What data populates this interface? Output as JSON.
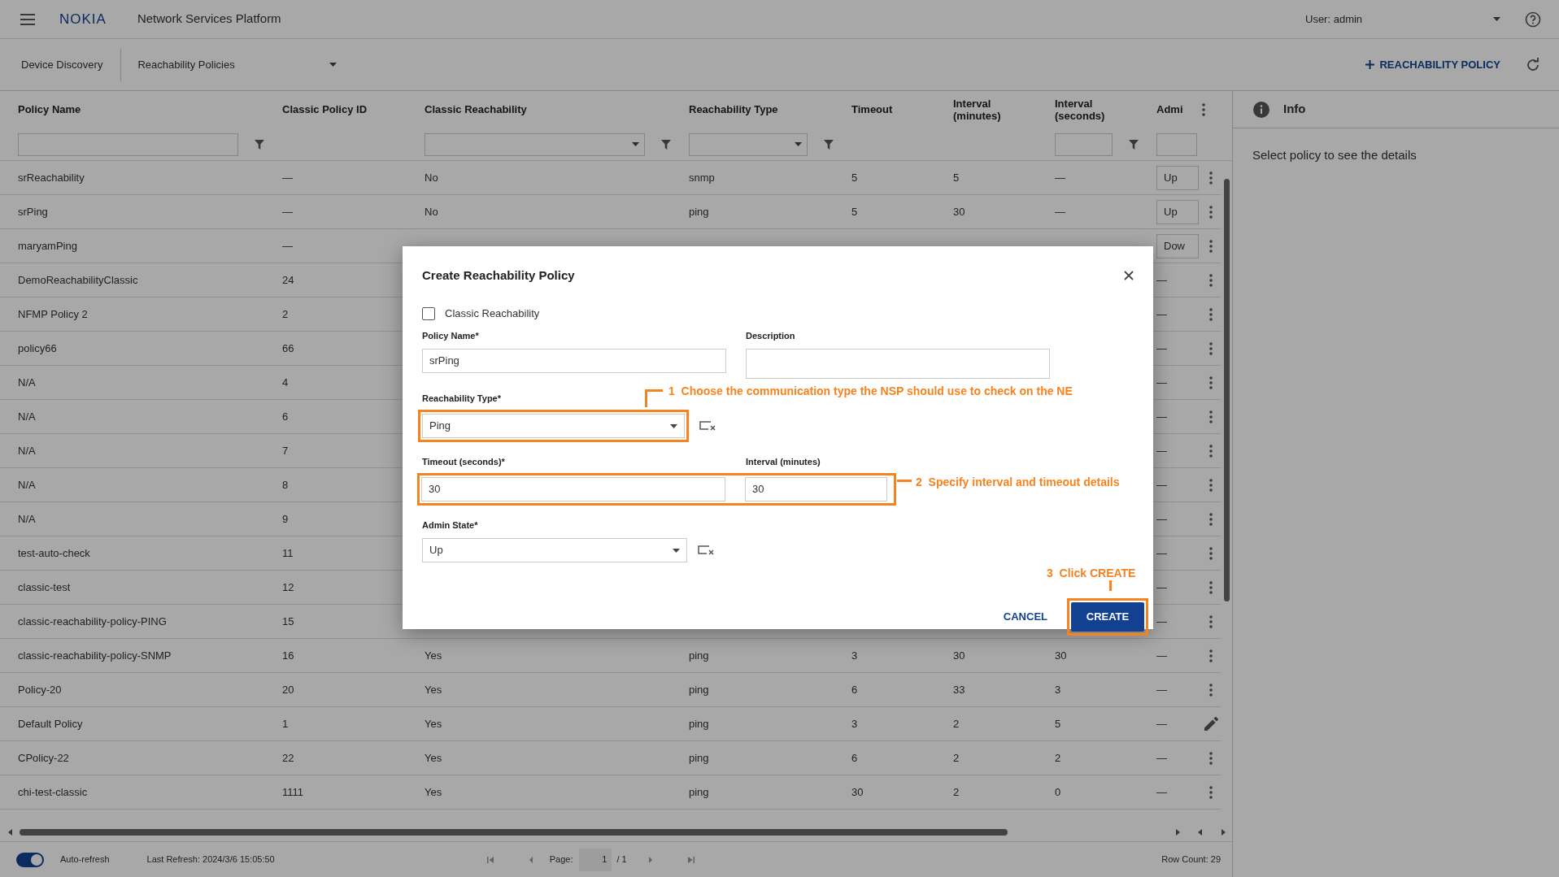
{
  "header": {
    "logo": "NOKIA",
    "app_title": "Network Services Platform",
    "user": "User: admin"
  },
  "toolbar": {
    "breadcrumb": "Device Discovery",
    "view_select": "Reachability Policies",
    "add_button": "REACHABILITY POLICY"
  },
  "table": {
    "columns": [
      {
        "label": "Policy Name",
        "kind": "text"
      },
      {
        "label": "Classic Policy ID"
      },
      {
        "label": "Classic Reachability",
        "kind": "select"
      },
      {
        "label": "Reachability Type",
        "kind": "select"
      },
      {
        "label": "Timeout"
      },
      {
        "label": "Interval (minutes)"
      },
      {
        "label": "Interval (seconds)",
        "kind": "text"
      },
      {
        "label": "Admi",
        "kind": "stub"
      }
    ],
    "rows": [
      {
        "name": "srReachability",
        "id": "—",
        "classic": "No",
        "type": "snmp",
        "timeout": "5",
        "interval_min": "5",
        "interval_sec": "—",
        "admin": {
          "value": "Up",
          "kind": "field"
        },
        "action": {
          "kind": "menu"
        }
      },
      {
        "name": "srPing",
        "id": "—",
        "classic": "No",
        "type": "ping",
        "timeout": "5",
        "interval_min": "30",
        "interval_sec": "—",
        "admin": {
          "value": "Up",
          "kind": "field"
        },
        "action": {
          "kind": "menu"
        }
      },
      {
        "name": "maryamPing",
        "id": "—",
        "admin": {
          "value": "Dow",
          "kind": "field"
        },
        "action": {
          "kind": "menu"
        }
      },
      {
        "name": "DemoReachabilityClassic",
        "id": "24",
        "admin": {
          "value": "—",
          "kind": "text"
        },
        "action": {
          "kind": "menu"
        }
      },
      {
        "name": "NFMP Policy 2",
        "id": "2",
        "admin": {
          "value": "—",
          "kind": "text"
        },
        "action": {
          "kind": "menu"
        }
      },
      {
        "name": "policy66",
        "id": "66",
        "admin": {
          "value": "—",
          "kind": "text"
        },
        "action": {
          "kind": "menu"
        }
      },
      {
        "name": "N/A",
        "id": "4",
        "admin": {
          "value": "—",
          "kind": "text"
        },
        "action": {
          "kind": "menu"
        }
      },
      {
        "name": "N/A",
        "id": "6",
        "admin": {
          "value": "—",
          "kind": "text"
        },
        "action": {
          "kind": "menu"
        }
      },
      {
        "name": "N/A",
        "id": "7",
        "admin": {
          "value": "—",
          "kind": "text"
        },
        "action": {
          "kind": "menu"
        }
      },
      {
        "name": "N/A",
        "id": "8",
        "admin": {
          "value": "—",
          "kind": "text"
        },
        "action": {
          "kind": "menu"
        }
      },
      {
        "name": "N/A",
        "id": "9",
        "admin": {
          "value": "—",
          "kind": "text"
        },
        "action": {
          "kind": "menu"
        }
      },
      {
        "name": "test-auto-check",
        "id": "11",
        "admin": {
          "value": "—",
          "kind": "text"
        },
        "action": {
          "kind": "menu"
        }
      },
      {
        "name": "classic-test",
        "id": "12",
        "admin": {
          "value": "—",
          "kind": "text"
        },
        "action": {
          "kind": "menu"
        }
      },
      {
        "name": "classic-reachability-policy-PING",
        "id": "15",
        "admin": {
          "value": "—",
          "kind": "text"
        },
        "action": {
          "kind": "menu"
        }
      },
      {
        "name": "classic-reachability-policy-SNMP",
        "id": "16",
        "classic": "Yes",
        "type": "ping",
        "timeout": "3",
        "interval_min": "30",
        "interval_sec": "30",
        "admin": {
          "value": "—",
          "kind": "text"
        },
        "action": {
          "kind": "menu"
        }
      },
      {
        "name": "Policy-20",
        "id": "20",
        "classic": "Yes",
        "type": "ping",
        "timeout": "6",
        "interval_min": "33",
        "interval_sec": "3",
        "admin": {
          "value": "—",
          "kind": "text"
        },
        "action": {
          "kind": "menu"
        }
      },
      {
        "name": "Default Policy",
        "id": "1",
        "classic": "Yes",
        "type": "ping",
        "timeout": "3",
        "interval_min": "2",
        "interval_sec": "5",
        "admin": {
          "value": "—",
          "kind": "text"
        },
        "action": {
          "kind": "edit"
        }
      },
      {
        "name": "CPolicy-22",
        "id": "22",
        "classic": "Yes",
        "type": "ping",
        "timeout": "6",
        "interval_min": "2",
        "interval_sec": "2",
        "admin": {
          "value": "—",
          "kind": "text"
        },
        "action": {
          "kind": "menu"
        }
      },
      {
        "name": "chi-test-classic",
        "id": "1111",
        "classic": "Yes",
        "type": "ping",
        "timeout": "30",
        "interval_min": "2",
        "interval_sec": "0",
        "admin": {
          "value": "—",
          "kind": "text"
        },
        "action": {
          "kind": "menu"
        }
      }
    ]
  },
  "info": {
    "title": "Info",
    "message": "Select policy to see the details"
  },
  "footer": {
    "auto_refresh": {
      "label": "Auto-refresh",
      "on": true
    },
    "last_refresh": "Last Refresh: 2024/3/6 15:05:50",
    "page_label": "Page:",
    "page": "1",
    "page_total": "/ 1",
    "row_count": "Row Count: 29"
  },
  "modal": {
    "title": "Create Reachability Policy",
    "classic": {
      "label": "Classic Reachability",
      "checked": false
    },
    "policy_name": {
      "label": "Policy Name*",
      "value": "srPing"
    },
    "description": {
      "label": "Description"
    },
    "reachability_type": {
      "label": "Reachability Type*",
      "value": "Ping",
      "highlighted": true
    },
    "timing": {
      "highlighted": true,
      "timeout": {
        "label": "Timeout (seconds)*",
        "value": "30"
      },
      "interval": {
        "label": "Interval (minutes)",
        "value": "30"
      }
    },
    "admin_state": {
      "label": "Admin State*",
      "value": "Up"
    },
    "cancel": {
      "label": "CANCEL"
    },
    "create": {
      "label": "CREATE",
      "highlighted": true
    },
    "annotations": [
      {
        "number": "1",
        "text": "Choose the communication type the NSP should use to check on the NE"
      },
      {
        "number": "2",
        "text": "Specify interval and timeout details"
      },
      {
        "number": "3",
        "text": "Click CREATE"
      }
    ]
  }
}
